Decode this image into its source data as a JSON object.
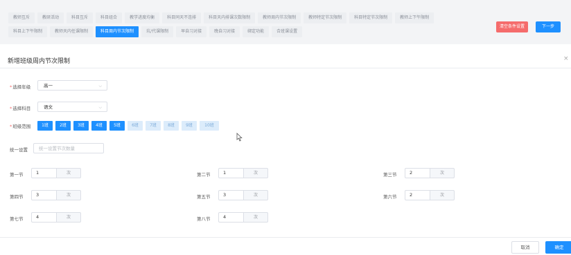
{
  "tabs": {
    "row1": [
      "教师互斥",
      "教研活动",
      "科目互斥",
      "科目组合",
      "教学进度均衡",
      "科目同天不连排",
      "科目天内排课次数限制",
      "教师周内节次限制",
      "教师特定节次限制",
      "科目特定节次限制",
      "教师上下午限制"
    ],
    "row2": [
      "科目上下午限制",
      "教师天内任课限制",
      "科目周内节次限制",
      "坑/代课限制",
      "早自习对接",
      "晚自习对接",
      "绑定功能",
      "合班课设置"
    ],
    "active_label": "科目周内节次限制"
  },
  "header_actions": {
    "reset_label": "清空条件设置",
    "next_label": "下一步"
  },
  "dialog": {
    "title": "新增班级周内节次限制",
    "close": "×",
    "grade": {
      "label": "选择年级",
      "required": "*",
      "value": "高一"
    },
    "subject": {
      "label": "选择科目",
      "required": "*",
      "value": "语文"
    },
    "class_range": {
      "label": "班级范围",
      "required": "*",
      "classes": [
        {
          "name": "1班",
          "selected": true
        },
        {
          "name": "2班",
          "selected": true
        },
        {
          "name": "3班",
          "selected": true
        },
        {
          "name": "4班",
          "selected": true
        },
        {
          "name": "5班",
          "selected": true
        },
        {
          "name": "6班",
          "selected": false
        },
        {
          "name": "7班",
          "selected": false
        },
        {
          "name": "8班",
          "selected": false
        },
        {
          "name": "9班",
          "selected": false
        },
        {
          "name": "10班",
          "selected": false
        }
      ]
    },
    "unified": {
      "label": "统一设置",
      "placeholder": "统一设置节次数量"
    },
    "unit": "次",
    "periods": [
      {
        "label": "第一节",
        "value": "1"
      },
      {
        "label": "第二节",
        "value": "1"
      },
      {
        "label": "第三节",
        "value": "2"
      },
      {
        "label": "第四节",
        "value": "3"
      },
      {
        "label": "第五节",
        "value": "3"
      },
      {
        "label": "第六节",
        "value": "2"
      },
      {
        "label": "第七节",
        "value": "4"
      },
      {
        "label": "第八节",
        "value": "4"
      }
    ],
    "cancel_label": "取消",
    "ok_label": "确定"
  },
  "colors": {
    "primary": "#1e90ff",
    "danger": "#f56c6c",
    "light_blue": "#dcecfb"
  },
  "icons": {
    "close": "close-icon",
    "chevron": "chevron-down-icon",
    "cursor": "mouse-cursor-icon"
  }
}
